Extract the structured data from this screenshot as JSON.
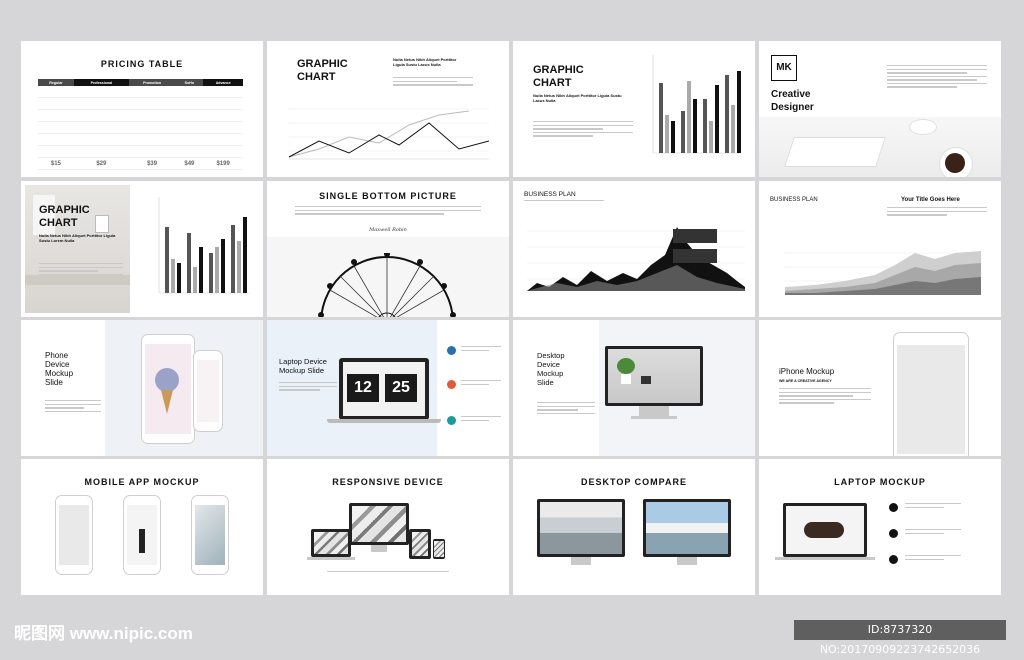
{
  "slides": {
    "pricing": {
      "title": "PRICING TABLE",
      "columns": [
        "Regular",
        "Professional",
        "Promotion",
        "SoHo",
        "Advance"
      ],
      "prices": [
        "$15",
        "$29",
        "$39",
        "$49",
        "$199"
      ]
    },
    "graphic_chart_1": {
      "title_line1": "GRAPHIC",
      "title_line2": "CHART",
      "sub": "Nulla Netus Nibh Aliquet Porttitor Ligula Sustu Lacus Nulla"
    },
    "graphic_chart_2": {
      "title_line1": "GRAPHIC",
      "title_line2": "CHART",
      "sub": "Nulla Netus Nibh Aliquet Porttitor Ligula Sustu Lacus Nulla"
    },
    "creative": {
      "logo": "MK",
      "title_line1": "Creative",
      "title_line2": "Designer"
    },
    "graphic_chart_3": {
      "title_line1": "GRAPHIC",
      "title_line2": "CHART",
      "sub": "Nulla Netus Nibh Aliquet Porttitor Ligula Sustu Lorem Nulla"
    },
    "single_bottom": {
      "title": "SINGLE BOTTOM PICTURE",
      "signature": "Maxwell Robin"
    },
    "business_plan_1": {
      "title": "BUSINESS PLAN"
    },
    "business_plan_2": {
      "title": "BUSINESS PLAN",
      "heading": "Your Title Goes Here"
    },
    "phone_device": {
      "title_line1": "Phone",
      "title_line2": "Device",
      "title_line3": "Mockup",
      "title_line4": "Slide"
    },
    "laptop_device": {
      "title_line1": "Laptop Device",
      "title_line2": "Mockup Slide",
      "clock_left": "12",
      "clock_right": "25"
    },
    "desktop_device": {
      "title_line1": "Desktop",
      "title_line2": "Device",
      "title_line3": "Mockup",
      "title_line4": "Slide"
    },
    "iphone": {
      "title": "iPhone Mockup",
      "sub": "WE ARE A CREATIVE AGENCY"
    },
    "mobile_app": {
      "title": "MOBILE APP MOCKUP"
    },
    "responsive": {
      "title": "RESPONSIVE DEVICE"
    },
    "desktop_compare": {
      "title": "DESKTOP COMPARE"
    },
    "laptop_mockup": {
      "title": "LAPTOP MOCKUP"
    }
  },
  "watermark": {
    "site": "昵图网 www.nipic.com",
    "id": "ID:8737320 NO:20170909223742652036"
  },
  "colors": {
    "background": "#d6d6d8",
    "slide": "#ffffff",
    "dark": "#111111",
    "teal": "#1a9c9c",
    "blue": "#2b6fb3"
  }
}
